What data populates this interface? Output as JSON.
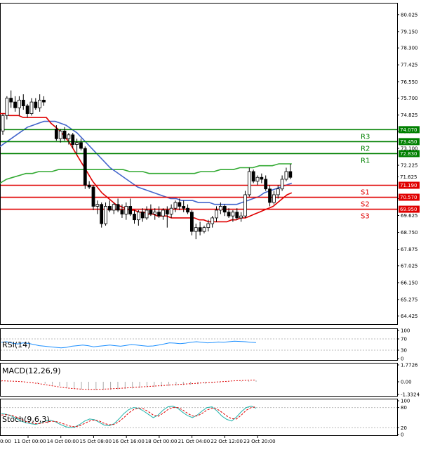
{
  "chart_data": {
    "type": "candlestick",
    "price_axis": {
      "ticks": [
        "80.025",
        "79.150",
        "78.300",
        "77.425",
        "76.550",
        "75.700",
        "74.825",
        "73.975",
        "73.100",
        "72.225",
        "71.625",
        "70.500",
        "69.625",
        "68.750",
        "67.875",
        "67.025",
        "66.150",
        "65.275",
        "64.425"
      ],
      "ylim": [
        64.0,
        80.6
      ]
    },
    "time_labels": [
      "11 Oct 00:00",
      "14 Oct 00:00",
      "15 Oct 08:00",
      "16 Oct 16:00",
      "18 Oct 00:00",
      "21 Oct 04:00",
      "22 Oct 12:00",
      "23 Oct 20:00"
    ],
    "time_label_prefix": "0:00",
    "candles": [
      {
        "o": 74.0,
        "h": 74.9,
        "l": 73.8,
        "c": 74.8
      },
      {
        "o": 74.8,
        "h": 75.8,
        "l": 74.6,
        "c": 75.7
      },
      {
        "o": 75.7,
        "h": 76.1,
        "l": 75.2,
        "c": 75.5
      },
      {
        "o": 75.5,
        "h": 75.8,
        "l": 75.0,
        "c": 75.2
      },
      {
        "o": 75.2,
        "h": 75.8,
        "l": 74.8,
        "c": 75.6
      },
      {
        "o": 75.6,
        "h": 75.9,
        "l": 75.1,
        "c": 75.3
      },
      {
        "o": 75.3,
        "h": 75.4,
        "l": 74.7,
        "c": 74.9
      },
      {
        "o": 74.9,
        "h": 75.7,
        "l": 74.8,
        "c": 75.5
      },
      {
        "o": 75.5,
        "h": 75.7,
        "l": 75.1,
        "c": 75.2
      },
      {
        "o": 75.2,
        "h": 75.9,
        "l": 75.0,
        "c": 75.6
      },
      {
        "o": 75.6,
        "h": 75.8,
        "l": 75.3,
        "c": 75.5
      },
      {
        "o": 74.1,
        "h": 74.3,
        "l": 73.5,
        "c": 73.6
      },
      {
        "o": 73.6,
        "h": 74.1,
        "l": 73.4,
        "c": 74.0
      },
      {
        "o": 74.0,
        "h": 74.2,
        "l": 73.5,
        "c": 73.6
      },
      {
        "o": 73.6,
        "h": 73.9,
        "l": 73.3,
        "c": 73.8
      },
      {
        "o": 73.8,
        "h": 73.9,
        "l": 73.1,
        "c": 73.3
      },
      {
        "o": 73.3,
        "h": 73.6,
        "l": 72.8,
        "c": 73.4
      },
      {
        "o": 73.4,
        "h": 73.6,
        "l": 73.0,
        "c": 73.1
      },
      {
        "o": 73.1,
        "h": 73.2,
        "l": 71.0,
        "c": 71.2
      },
      {
        "o": 71.2,
        "h": 71.4,
        "l": 71.0,
        "c": 71.1
      },
      {
        "o": 71.1,
        "h": 71.2,
        "l": 69.9,
        "c": 70.1
      },
      {
        "o": 70.1,
        "h": 70.4,
        "l": 69.7,
        "c": 70.2
      },
      {
        "o": 70.2,
        "h": 70.3,
        "l": 69.0,
        "c": 69.2
      },
      {
        "o": 69.2,
        "h": 70.3,
        "l": 69.1,
        "c": 70.1
      },
      {
        "o": 70.1,
        "h": 70.4,
        "l": 69.8,
        "c": 69.9
      },
      {
        "o": 69.9,
        "h": 70.3,
        "l": 69.7,
        "c": 70.2
      },
      {
        "o": 70.2,
        "h": 70.5,
        "l": 69.8,
        "c": 69.9
      },
      {
        "o": 69.9,
        "h": 70.2,
        "l": 69.5,
        "c": 69.7
      },
      {
        "o": 69.7,
        "h": 70.3,
        "l": 69.4,
        "c": 70.1
      },
      {
        "o": 70.1,
        "h": 70.5,
        "l": 69.6,
        "c": 69.7
      },
      {
        "o": 69.7,
        "h": 69.9,
        "l": 69.2,
        "c": 69.4
      },
      {
        "o": 69.4,
        "h": 69.9,
        "l": 69.1,
        "c": 69.8
      },
      {
        "o": 69.8,
        "h": 70.0,
        "l": 69.3,
        "c": 69.5
      },
      {
        "o": 69.5,
        "h": 70.1,
        "l": 69.4,
        "c": 69.9
      },
      {
        "o": 69.9,
        "h": 70.2,
        "l": 69.6,
        "c": 69.7
      },
      {
        "o": 69.7,
        "h": 70.0,
        "l": 69.4,
        "c": 69.8
      },
      {
        "o": 69.8,
        "h": 70.1,
        "l": 69.5,
        "c": 69.6
      },
      {
        "o": 69.6,
        "h": 70.0,
        "l": 69.4,
        "c": 69.9
      },
      {
        "o": 69.9,
        "h": 70.1,
        "l": 69.0,
        "c": 69.7
      },
      {
        "o": 69.7,
        "h": 70.2,
        "l": 69.5,
        "c": 70.0
      },
      {
        "o": 70.0,
        "h": 70.4,
        "l": 69.8,
        "c": 70.3
      },
      {
        "o": 70.3,
        "h": 70.5,
        "l": 69.9,
        "c": 70.1
      },
      {
        "o": 70.1,
        "h": 70.4,
        "l": 69.8,
        "c": 70.0
      },
      {
        "o": 70.0,
        "h": 70.2,
        "l": 69.7,
        "c": 69.8
      },
      {
        "o": 69.8,
        "h": 69.9,
        "l": 68.6,
        "c": 68.8
      },
      {
        "o": 68.8,
        "h": 69.2,
        "l": 68.4,
        "c": 69.0
      },
      {
        "o": 69.0,
        "h": 69.3,
        "l": 68.6,
        "c": 68.8
      },
      {
        "o": 68.8,
        "h": 69.1,
        "l": 68.7,
        "c": 69.0
      },
      {
        "o": 69.0,
        "h": 69.4,
        "l": 68.8,
        "c": 69.2
      },
      {
        "o": 69.2,
        "h": 69.6,
        "l": 69.0,
        "c": 69.5
      },
      {
        "o": 69.5,
        "h": 70.1,
        "l": 69.3,
        "c": 69.9
      },
      {
        "o": 69.9,
        "h": 70.3,
        "l": 69.7,
        "c": 70.1
      },
      {
        "o": 70.1,
        "h": 70.2,
        "l": 69.6,
        "c": 69.8
      },
      {
        "o": 69.8,
        "h": 70.0,
        "l": 69.5,
        "c": 69.6
      },
      {
        "o": 69.6,
        "h": 69.9,
        "l": 69.3,
        "c": 69.8
      },
      {
        "o": 69.8,
        "h": 70.0,
        "l": 69.4,
        "c": 69.5
      },
      {
        "o": 69.5,
        "h": 69.8,
        "l": 69.3,
        "c": 69.6
      },
      {
        "o": 69.6,
        "h": 70.9,
        "l": 69.5,
        "c": 70.7
      },
      {
        "o": 70.7,
        "h": 72.1,
        "l": 70.6,
        "c": 71.9
      },
      {
        "o": 71.9,
        "h": 72.0,
        "l": 71.3,
        "c": 71.4
      },
      {
        "o": 71.4,
        "h": 71.7,
        "l": 71.2,
        "c": 71.6
      },
      {
        "o": 71.6,
        "h": 71.8,
        "l": 71.3,
        "c": 71.5
      },
      {
        "o": 71.5,
        "h": 71.7,
        "l": 70.9,
        "c": 71.0
      },
      {
        "o": 71.0,
        "h": 71.2,
        "l": 70.1,
        "c": 70.3
      },
      {
        "o": 70.3,
        "h": 70.9,
        "l": 70.2,
        "c": 70.7
      },
      {
        "o": 70.7,
        "h": 71.2,
        "l": 70.5,
        "c": 71.0
      },
      {
        "o": 71.0,
        "h": 71.7,
        "l": 70.9,
        "c": 71.5
      },
      {
        "o": 71.5,
        "h": 72.1,
        "l": 71.4,
        "c": 71.9
      },
      {
        "o": 71.9,
        "h": 72.3,
        "l": 71.5,
        "c": 71.6
      }
    ],
    "gap_after_index": 10,
    "ma_red": [
      74.9,
      74.9,
      74.8,
      74.8,
      74.8,
      74.7,
      74.7,
      74.7,
      74.7,
      74.7,
      74.7,
      74.4,
      74.2,
      74.0,
      73.7,
      73.4,
      73.0,
      72.6,
      72.2,
      71.8,
      71.4,
      71.1,
      70.8,
      70.6,
      70.4,
      70.2,
      70.1,
      70.0,
      69.9,
      69.9,
      69.8,
      69.8,
      69.7,
      69.7,
      69.6,
      69.6,
      69.6,
      69.5,
      69.5,
      69.5,
      69.5,
      69.5,
      69.5,
      69.4,
      69.4,
      69.3,
      69.3,
      69.3,
      69.3,
      69.3,
      69.4,
      69.4,
      69.5,
      69.5,
      69.6,
      69.7,
      69.8,
      69.9,
      70.0,
      70.1,
      70.3,
      70.5,
      70.7,
      70.8
    ],
    "ma_blue": [
      73.2,
      73.4,
      73.6,
      73.8,
      74.0,
      74.2,
      74.3,
      74.4,
      74.5,
      74.5,
      74.5,
      74.4,
      74.3,
      74.1,
      73.9,
      73.6,
      73.3,
      73.0,
      72.7,
      72.4,
      72.1,
      71.9,
      71.7,
      71.5,
      71.3,
      71.1,
      71.0,
      70.9,
      70.8,
      70.7,
      70.6,
      70.5,
      70.5,
      70.4,
      70.4,
      70.4,
      70.3,
      70.3,
      70.3,
      70.2,
      70.2,
      70.2,
      70.2,
      70.2,
      70.3,
      70.4,
      70.5,
      70.6,
      70.8,
      70.9,
      71.0,
      71.1,
      71.2,
      71.3
    ],
    "ma_green": [
      71.3,
      71.5,
      71.6,
      71.7,
      71.8,
      71.8,
      71.9,
      71.9,
      71.9,
      72.0,
      72.0,
      72.0,
      72.0,
      72.0,
      72.0,
      72.0,
      72.0,
      72.0,
      72.0,
      72.0,
      71.9,
      71.9,
      71.9,
      71.8,
      71.8,
      71.8,
      71.8,
      71.8,
      71.8,
      71.8,
      71.8,
      71.9,
      71.9,
      71.9,
      72.0,
      72.0,
      72.0,
      72.1,
      72.1,
      72.1,
      72.2,
      72.2,
      72.2,
      72.3,
      72.3,
      72.3
    ],
    "levels": [
      {
        "name": "R3",
        "value": 74.07,
        "tag": "74.070",
        "color": "#008000"
      },
      {
        "name": "R2",
        "value": 73.45,
        "tag": "73.450",
        "color": "#008000"
      },
      {
        "name": "R1",
        "value": 72.83,
        "tag": "72.830",
        "color": "#008000"
      },
      {
        "name": "S1",
        "value": 71.19,
        "tag": "71.190",
        "color": "#e00000"
      },
      {
        "name": "S2",
        "value": 70.57,
        "tag": "70.570",
        "color": "#e00000"
      },
      {
        "name": "S3",
        "value": 69.95,
        "tag": "69.950",
        "color": "#e00000"
      }
    ],
    "current_price": {
      "value": 71.625,
      "tag": "71.625"
    },
    "rsi": {
      "title": "RSI(14)",
      "ticks": [
        "100",
        "70",
        "30",
        "0"
      ],
      "values": [
        58,
        60,
        55,
        52,
        56,
        54,
        50,
        46,
        44,
        42,
        40,
        38,
        40,
        44,
        46,
        48,
        46,
        42,
        44,
        46,
        48,
        46,
        44,
        47,
        50,
        48,
        46,
        44,
        45,
        48,
        52,
        56,
        55,
        53,
        55,
        58,
        60,
        58,
        56,
        57,
        59,
        58,
        60,
        62,
        61,
        60,
        58,
        57
      ]
    },
    "macd": {
      "title": "MACD(12,26,9)",
      "ticks": [
        "1.7726",
        "0.00",
        "-1.3324"
      ],
      "hist": [
        0.05,
        0.04,
        0.03,
        0.02,
        0.0,
        -0.1,
        -0.2,
        -0.3,
        -0.45,
        -0.6,
        -0.72,
        -0.8,
        -0.85,
        -0.88,
        -0.86,
        -0.84,
        -0.8,
        -0.75,
        -0.7,
        -0.65,
        -0.6,
        -0.55,
        -0.5,
        -0.45,
        -0.4,
        -0.35,
        -0.3,
        -0.25,
        -0.2,
        -0.15,
        -0.1,
        -0.05,
        0.0,
        0.05,
        0.1,
        0.15
      ],
      "signal": [
        0.1,
        0.08,
        0.05,
        0.0,
        -0.08,
        -0.18,
        -0.3,
        -0.42,
        -0.55,
        -0.65,
        -0.72,
        -0.77,
        -0.8,
        -0.8,
        -0.78,
        -0.74,
        -0.7,
        -0.65,
        -0.6,
        -0.55,
        -0.5,
        -0.45,
        -0.4,
        -0.35,
        -0.3,
        -0.25,
        -0.2,
        -0.15,
        -0.1,
        -0.05,
        0.0,
        0.05,
        0.1,
        0.13,
        0.16,
        0.18
      ]
    },
    "stoch": {
      "title": "Stoch(9,6,3)",
      "ticks": [
        "100",
        "80",
        "20",
        "0"
      ],
      "k": [
        62,
        60,
        55,
        48,
        40,
        35,
        32,
        30,
        34,
        40,
        42,
        38,
        30,
        24,
        20,
        22,
        30,
        40,
        46,
        44,
        36,
        28,
        26,
        32,
        46,
        62,
        74,
        80,
        78,
        70,
        60,
        50,
        58,
        72,
        82,
        84,
        78,
        66,
        56,
        50,
        58,
        70,
        80,
        82,
        70,
        55,
        45,
        40,
        52,
        68,
        80,
        84,
        78
      ],
      "d": [
        58,
        59,
        57,
        52,
        45,
        39,
        35,
        32,
        33,
        36,
        39,
        39,
        35,
        30,
        25,
        23,
        26,
        33,
        40,
        43,
        40,
        33,
        29,
        30,
        38,
        50,
        64,
        74,
        78,
        76,
        68,
        58,
        54,
        63,
        74,
        80,
        80,
        73,
        63,
        55,
        55,
        63,
        73,
        78,
        76,
        66,
        55,
        47,
        46,
        58,
        72,
        80,
        82
      ]
    }
  }
}
